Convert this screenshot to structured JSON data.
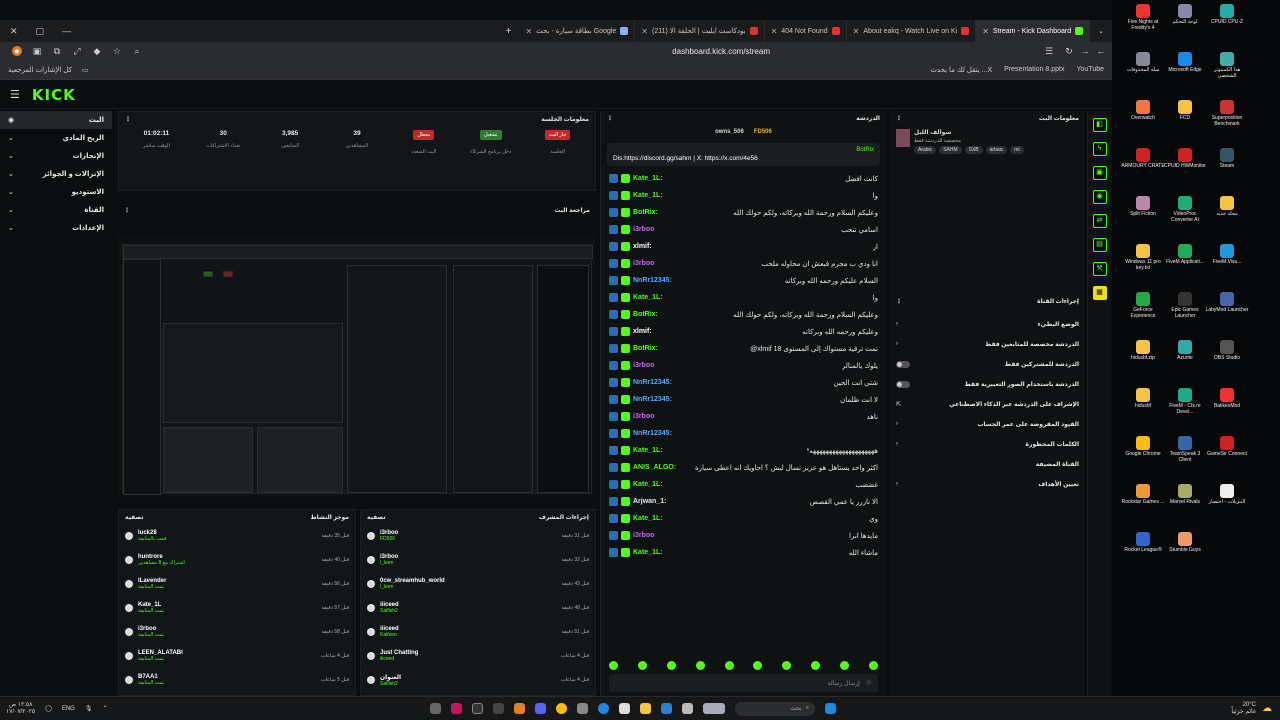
{
  "browser": {
    "tabs": [
      {
        "label": "Stream - Kick Dashboard",
        "active": true,
        "fav": "g"
      },
      {
        "label": "About eakq - Watch Live on Ki",
        "fav": "r"
      },
      {
        "label": "404 Not Found",
        "fav": "r"
      },
      {
        "label": "(211) بودكاست ايليت | الحلقة الا",
        "fav": "r"
      },
      {
        "label": "بطاقة سيارة - بحث Google",
        "fav": "b"
      }
    ],
    "url": "dashboard.kick.com/stream",
    "bookmarks_left": "كل الإشارات المرجعية",
    "bookmarks_right": [
      "YouTube",
      "Presentation 8.pptx",
      "يتقل لك ما يحدث ...X"
    ]
  },
  "kick": {
    "logo": "KICK",
    "sidebar": [
      {
        "label": "البث",
        "active": true
      },
      {
        "label": "الربح المادي"
      },
      {
        "label": "الإنجازات"
      },
      {
        "label": "الإنزالات و الجوائز"
      },
      {
        "label": "الاستوديو"
      },
      {
        "label": "القناة"
      },
      {
        "label": "الإعدادات"
      }
    ],
    "session": {
      "title": "معلومات الجلسة",
      "stats": [
        {
          "value": "01:02:11",
          "label": "الوقت مباشر"
        },
        {
          "value": "30",
          "label": "تعداد الاشتراكات"
        },
        {
          "value": "3,985",
          "label": "المتابعين"
        },
        {
          "value": "39",
          "label": "المشاهدين"
        },
        {
          "badge": "معطل",
          "label": "البث المتعدد",
          "color": "#c62828"
        },
        {
          "badge": "تشغيل",
          "label": "دخل برنامج الشركاء",
          "color": "#2e7d32"
        },
        {
          "badge": "جار البث",
          "label": "الجلسة",
          "color": "#c62828"
        }
      ]
    },
    "preview_title": "مراجعة البث",
    "recent_events": {
      "title": "موجز النشاط",
      "filter": "تصفية",
      "rows": [
        {
          "name": "luck28",
          "sub": "قمت بالمتابعة",
          "time": "قبل 35 دقيقة"
        },
        {
          "name": "huntrore",
          "sub": "اشتراك مع 8 مشاهدين",
          "time": "قبل 40 دقيقة"
        },
        {
          "name": "lLavender",
          "sub": "تمت المتابعة",
          "time": "قبل 56 دقيقة"
        },
        {
          "name": "Kate_1L",
          "sub": "تمت المتابعة",
          "time": "قبل 57 دقيقة"
        },
        {
          "name": "i3rboo",
          "sub": "تمت المتابعة",
          "time": "قبل 58 دقيقة"
        },
        {
          "name": "LEEN_ALATABI",
          "sub": "تمت المتابعة",
          "time": "قبل 4 ساعات"
        },
        {
          "name": "B7AA1",
          "sub": "تمت المتابعة",
          "time": "قبل 5 ساعات"
        }
      ]
    },
    "mod_actions": {
      "title": "إجراءات المشرف",
      "filter": "تصفية",
      "rows": [
        {
          "name": "i3rboo",
          "sub": "FD506",
          "time": "قبل 31 دقيقة"
        },
        {
          "name": "i3rboo",
          "sub": "l_leen",
          "time": "قبل 32 دقيقة"
        },
        {
          "name": "0cw_streamhub_world",
          "sub": "l_leen",
          "time": "قبل 43 دقيقة"
        },
        {
          "name": "iiiceed",
          "sub": "Saifish2",
          "time": "قبل 48 دقيقة"
        },
        {
          "name": "iiiceed",
          "sub": "Kaifzen",
          "time": "قبل 51 دقيقة"
        },
        {
          "name": "Just Chatting",
          "sub": "iiiceed",
          "time": "قبل 4 ساعات"
        },
        {
          "name": "العنوان",
          "sub": "Saifish2",
          "time": "قبل 4 ساعات"
        }
      ]
    },
    "chat": {
      "title": "الدردشة",
      "top_users": [
        "FD506",
        "owns_506"
      ],
      "pinned_by": "BotRix",
      "pinned_text": "Dis:https://discord.gg/sahm | X: https://x.com/4e56",
      "messages": [
        {
          "user": "Kate_1L:",
          "text": "كانت افضل",
          "color": "#53fc18"
        },
        {
          "user": "Kate_1L:",
          "text": "وا",
          "color": "#53fc18"
        },
        {
          "user": "BotRix:",
          "text": "وعليكم السلام ورحمة الله وبركاته، ولكم حولك الله",
          "color": "#53fc18"
        },
        {
          "user": "i3rboo",
          "text": "اسامي تتحب",
          "color": "#c56cf0"
        },
        {
          "user": "xlmif:",
          "text": "ار",
          "color": "#ffffff"
        },
        {
          "user": "i3rboo",
          "text": "انا ودي ب مجرم قبعش ان محاوله ملحب",
          "color": "#c56cf0"
        },
        {
          "user": "NnRr12345:",
          "text": "السلام عليكم ورحمه الله وبركاته",
          "color": "#5fa8ff"
        },
        {
          "user": "Kate_1L:",
          "text": "وا",
          "color": "#53fc18"
        },
        {
          "user": "BotRix:",
          "text": "وعليكم السلام ورحمة الله وبركاته، ولكم حولك الله",
          "color": "#53fc18"
        },
        {
          "user": "xlmif:",
          "text": "وعليكم ورحمه الله وبركاته",
          "color": "#ffffff"
        },
        {
          "user": "BotRix:",
          "text": "@xlmif 18 تمت ترقية مستواك إلى المستوى",
          "color": "#53fc18"
        },
        {
          "user": "i3rboo",
          "text": "يلوك يالمنالر",
          "color": "#c56cf0"
        },
        {
          "user": "NnRr12345:",
          "text": "شتي انت الحين",
          "color": "#5fa8ff"
        },
        {
          "user": "NnRr12345:",
          "text": "لا انت ظلمان",
          "color": "#5fa8ff"
        },
        {
          "user": "i3rboo",
          "text": "ناهد",
          "color": "#c56cf0"
        },
        {
          "user": "NnRr12345:",
          "text": "",
          "color": "#5fa8ff"
        },
        {
          "user": "Kate_1L:",
          "text": "*ههههههههههههههههههههه",
          "color": "#53fc18"
        },
        {
          "user": "ANIS_ALGO:",
          "text": "اكثر واحد يستاهل هو عزيز تسأل ليش ؟ اجاويك انه اعطى سيارة",
          "color": "#53fc18"
        },
        {
          "user": "Kate_1L:",
          "text": "غضضب",
          "color": "#53fc18"
        },
        {
          "user": "Arjwan_1:",
          "text": "الا ناررر يا عمي القصص",
          "color": "#e8e8e8"
        },
        {
          "user": "Kate_1L:",
          "text": "وي",
          "color": "#53fc18"
        },
        {
          "user": "i3rboo",
          "text": "مايدها ابرا",
          "color": "#c56cf0"
        },
        {
          "user": "Kate_1L:",
          "text": "ماشاء الله",
          "color": "#53fc18"
        }
      ],
      "input_placeholder": "إرسال رسالة"
    },
    "stream_info": {
      "title": "معلومات البث",
      "category_label": "سوالف الليل",
      "sub": "مخصصة للدردشة فقط",
      "tags": [
        "Arabic",
        "SAHM",
        "SXB",
        "arbaic",
        "ml"
      ]
    },
    "chat_actions": {
      "title": "إجراءات القناة",
      "rows": [
        {
          "label": "الوضع البطيء",
          "type": "chevron"
        },
        {
          "label": "الدردشة مخصصة للمتابعين فقط",
          "type": "chevron"
        },
        {
          "label": "الدردشة للمشتركين فقط",
          "type": "toggle"
        },
        {
          "label": "الدردشة باستخدام الصور التعبيرية فقط",
          "type": "toggle"
        },
        {
          "label": "الإشراف على الدردشة عبر الذكاء الاصطناعي",
          "type": "link"
        },
        {
          "label": "القيود المفروضة على عمر الحساب",
          "type": "chevron"
        },
        {
          "label": "الكلمات المحظورة",
          "type": "chevron"
        },
        {
          "label": "القناة المضيفة",
          "type": "text"
        },
        {
          "label": "تعيين الأهداف",
          "type": "chevron"
        }
      ]
    }
  },
  "desktop_icons": [
    "Five Nights at Freddy's 4",
    "لوحة التحكم",
    "CPUID CPU-Z",
    "سلة المحذوفات",
    "Microsoft Edge",
    "هذا الكمبيوتر الشخصي",
    "Overwatch",
    "FCD",
    "Superposition Benchmark",
    "ARMOURY CRATE",
    "CPUID HWMonitor",
    "Steam",
    "Split Fiction",
    "VideoProc Converter AI",
    "مجلد جديد",
    "Windows 11 pro key.txt",
    "FiveM Applicati...",
    "FiveM.Visu...",
    "GeForce Experience",
    "Epic Games Launcher",
    "LabyMod Launcher",
    "hidusbf.zip",
    "Azurite",
    "OBS Studio",
    "hidusbf",
    "FiveM - Cfx.re Devel...",
    "BakkesMod",
    "Google Chrome",
    "TeamSpeak 3 Client",
    "GameSir Connect",
    "Rockstar Games ...",
    "Marvel Rivals",
    "التنزيلات - اختصار",
    "Rocket League®",
    "Stumble Guys"
  ],
  "taskbar": {
    "time": "١٢:٥٨ ص",
    "date": "١٧/٠٧/٢٠٢٥",
    "lang": "ENG",
    "search": "بحث",
    "weather_temp": "20°C",
    "weather_text": "غائم جزئياً"
  }
}
